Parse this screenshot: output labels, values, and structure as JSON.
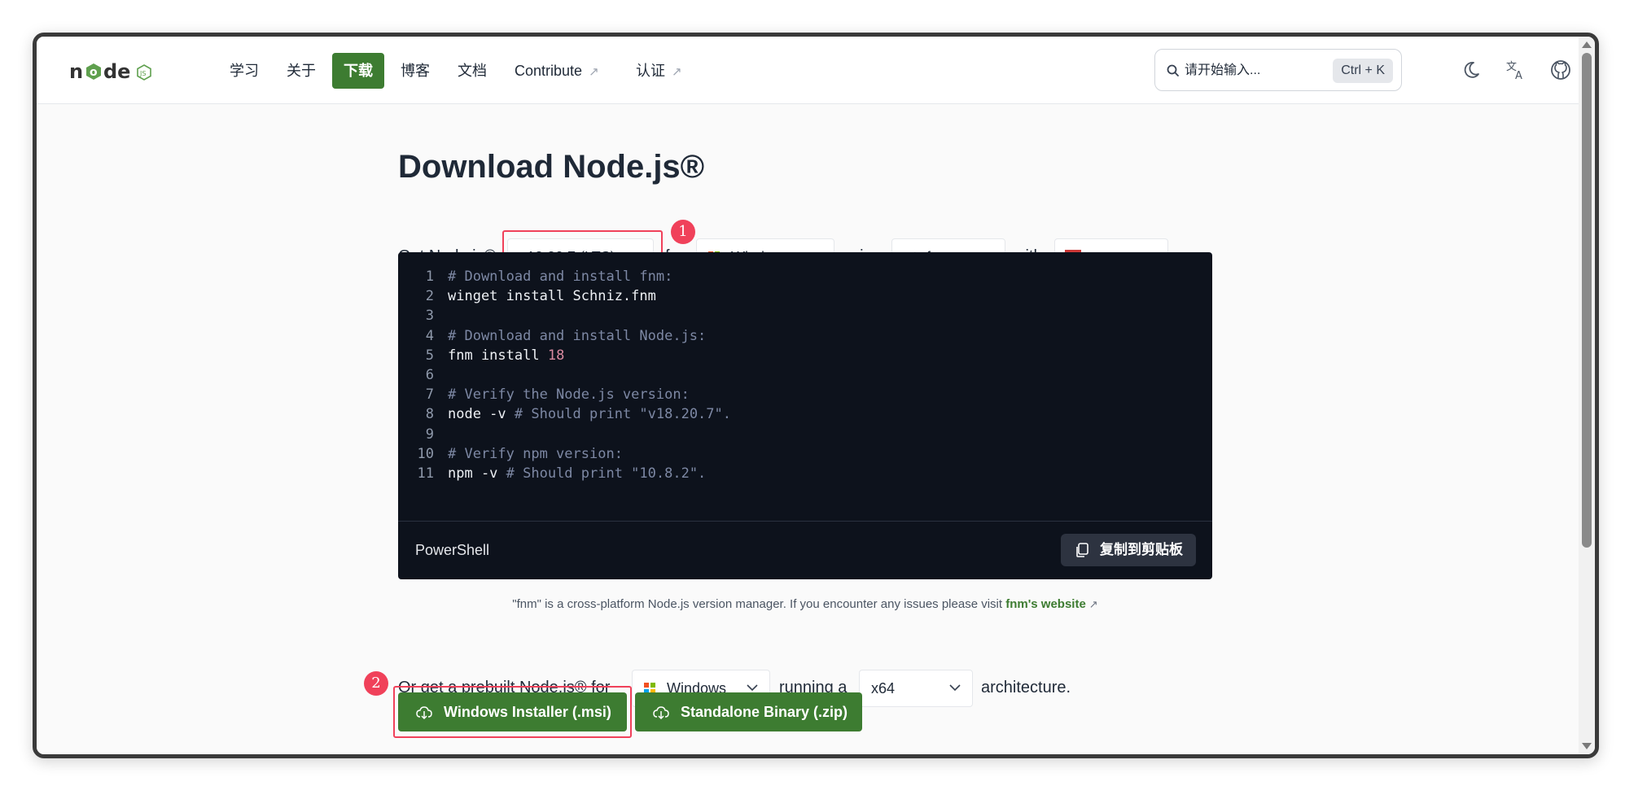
{
  "nav": {
    "logo_alt": "node js",
    "items": [
      {
        "label": "学习"
      },
      {
        "label": "关于"
      },
      {
        "label": "下载"
      },
      {
        "label": "博客"
      },
      {
        "label": "文档"
      },
      {
        "label": "Contribute",
        "external": true
      },
      {
        "label": "认证",
        "external": true
      }
    ],
    "active_item": "下载",
    "search": {
      "placeholder": "请开始输入...",
      "shortcut": "Ctrl + K"
    },
    "icons": [
      "moon-icon",
      "translate-icon",
      "github-icon"
    ]
  },
  "main": {
    "title": "Download Node.js®",
    "get_row": {
      "prefix": "Get Node.js®",
      "version": "v18.20.7 (LTS)",
      "for": "for",
      "os": "Windows",
      "using": "using",
      "manager": "fnm",
      "with": "with",
      "pkg_manager": "npm"
    },
    "code": {
      "lines": [
        {
          "n": "1",
          "tokens": [
            {
              "t": "# Download and install fnm:",
              "c": "comment"
            }
          ]
        },
        {
          "n": "2",
          "tokens": [
            {
              "t": "winget install Schniz.fnm",
              "c": "plain"
            }
          ]
        },
        {
          "n": "3",
          "tokens": []
        },
        {
          "n": "4",
          "tokens": [
            {
              "t": "# Download and install Node.js:",
              "c": "comment"
            }
          ]
        },
        {
          "n": "5",
          "tokens": [
            {
              "t": "fnm install ",
              "c": "plain"
            },
            {
              "t": "18",
              "c": "num"
            }
          ]
        },
        {
          "n": "6",
          "tokens": []
        },
        {
          "n": "7",
          "tokens": [
            {
              "t": "# Verify the Node.js version:",
              "c": "comment"
            }
          ]
        },
        {
          "n": "8",
          "tokens": [
            {
              "t": "node -v ",
              "c": "plain"
            },
            {
              "t": "# Should print \"v18.20.7\".",
              "c": "comment"
            }
          ]
        },
        {
          "n": "9",
          "tokens": []
        },
        {
          "n": "10",
          "tokens": [
            {
              "t": "# Verify npm version:",
              "c": "comment"
            }
          ]
        },
        {
          "n": "11",
          "tokens": [
            {
              "t": "npm -v ",
              "c": "plain"
            },
            {
              "t": "# Should print \"10.8.2\".",
              "c": "comment"
            }
          ]
        }
      ],
      "shell": "PowerShell",
      "copy_label": "复制到剪贴板"
    },
    "note": {
      "text": "\"fnm\" is a cross-platform Node.js version manager. If you encounter any issues please visit ",
      "link": "fnm's website"
    },
    "prebuilt_row": {
      "prefix": "Or get a prebuilt Node.js® for",
      "os": "Windows",
      "running": "running a",
      "arch": "x64",
      "suffix": "architecture."
    },
    "buttons": {
      "installer": "Windows Installer (.msi)",
      "binary": "Standalone Binary (.zip)"
    },
    "annotations": {
      "badge1": "1",
      "badge2": "2"
    }
  },
  "colors": {
    "brand_green": "#3d7c31",
    "highlight_red": "#f0415a",
    "code_bg": "#0d121c"
  }
}
